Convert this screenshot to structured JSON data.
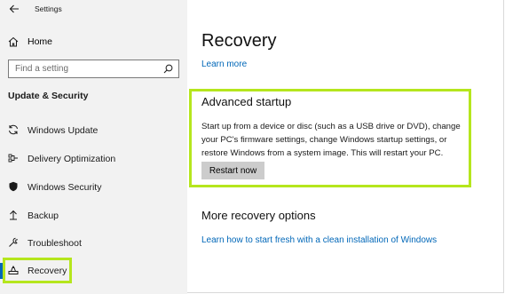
{
  "window": {
    "title": "Settings"
  },
  "sidebar": {
    "home_label": "Home",
    "search_placeholder": "Find a setting",
    "section_title": "Update & Security",
    "items": [
      {
        "label": "Windows Update",
        "icon": "sync-icon"
      },
      {
        "label": "Delivery Optimization",
        "icon": "delivery-optimization-icon"
      },
      {
        "label": "Windows Security",
        "icon": "shield-icon"
      },
      {
        "label": "Backup",
        "icon": "backup-arrow-icon"
      },
      {
        "label": "Troubleshoot",
        "icon": "wrench-icon"
      },
      {
        "label": "Recovery",
        "icon": "recovery-icon",
        "selected": true
      }
    ]
  },
  "main": {
    "title": "Recovery",
    "learn_more": "Learn more",
    "advanced_startup": {
      "title": "Advanced startup",
      "description": "Start up from a device or disc (such as a USB drive or DVD), change your PC's firmware settings, change Windows startup settings, or restore Windows from a system image. This will restart your PC.",
      "button_label": "Restart now"
    },
    "more_options": {
      "title": "More recovery options",
      "link": "Learn how to start fresh with a clean installation of Windows"
    }
  },
  "colors": {
    "accent": "#0067b8",
    "highlight": "#b5e61d",
    "sidebar_bg": "#f2f2f2",
    "button_bg": "#cccccc"
  }
}
